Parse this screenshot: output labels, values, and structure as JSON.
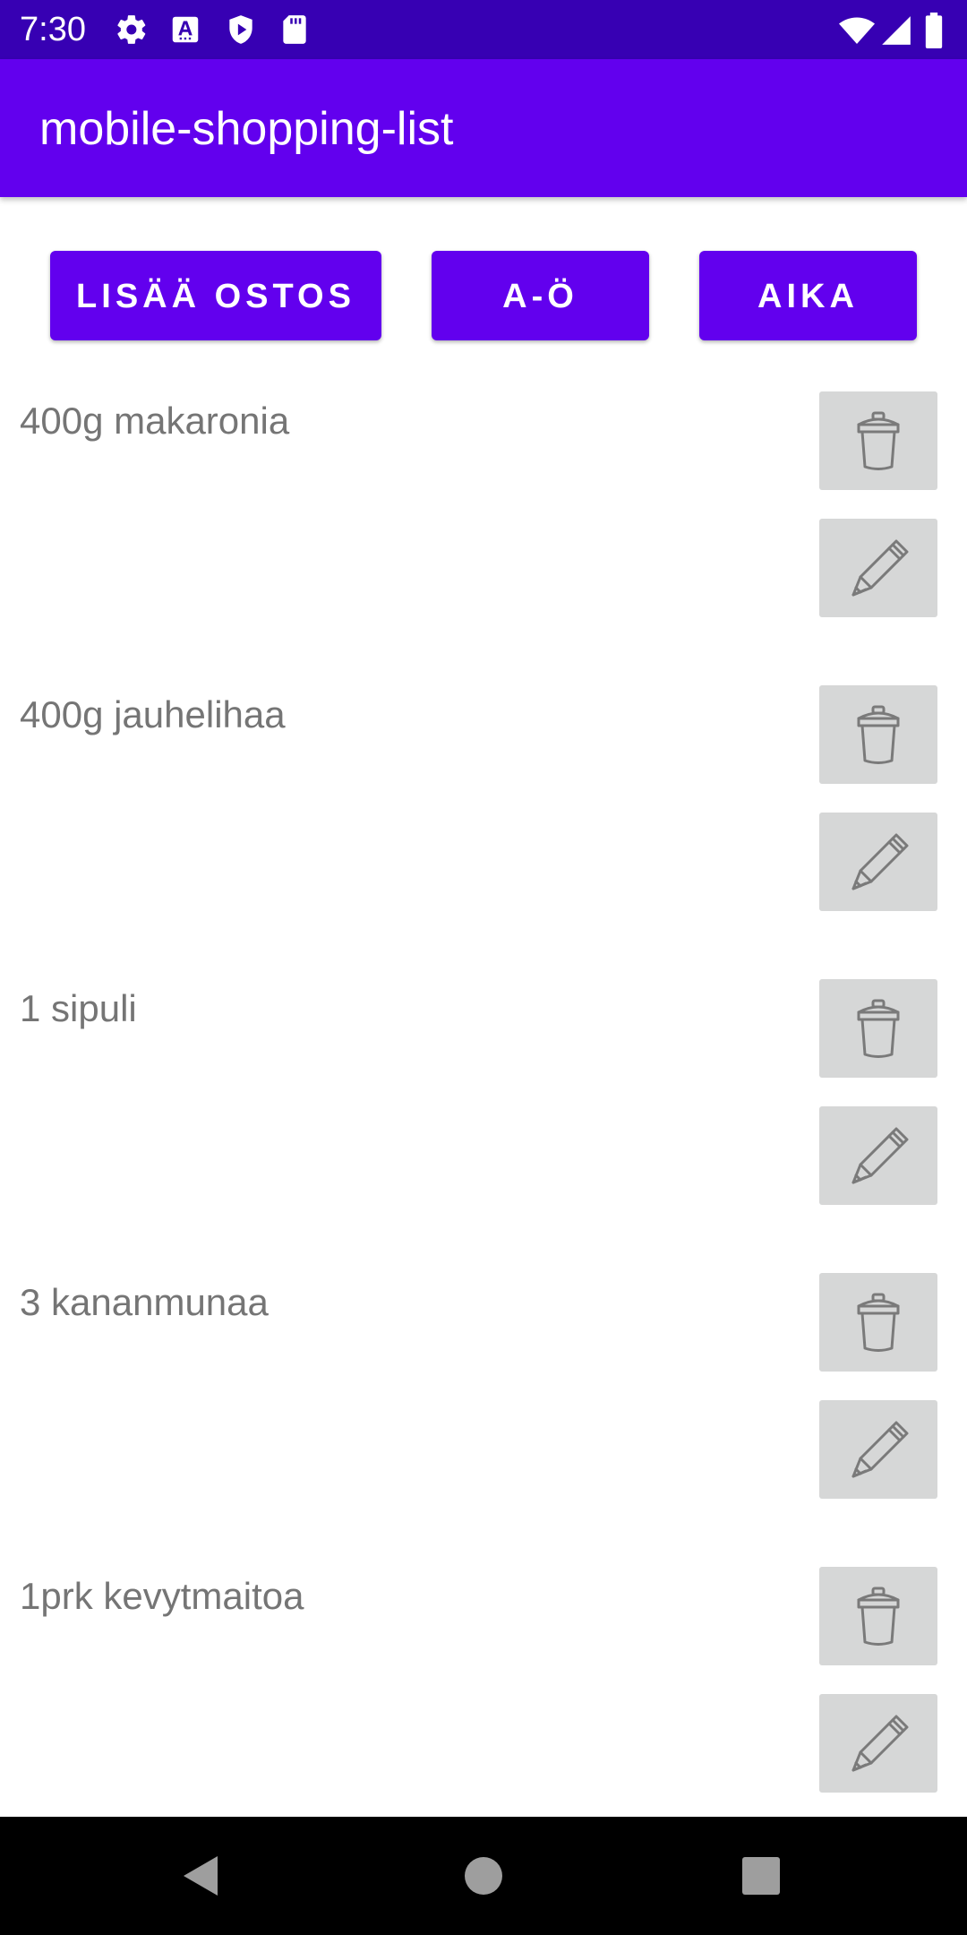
{
  "status_bar": {
    "time": "7:30",
    "left_icons": [
      "gear-icon",
      "font-a-icon",
      "shield-play-icon",
      "sd-card-icon"
    ],
    "right_icons": [
      "wifi-icon",
      "signal-icon",
      "battery-icon"
    ]
  },
  "app_bar": {
    "title": "mobile-shopping-list"
  },
  "actions": {
    "add_label": "LISÄÄ OSTOS",
    "sort_alpha_label": "A-Ö",
    "sort_time_label": "AIKA"
  },
  "items": [
    {
      "text": "400g makaronia"
    },
    {
      "text": "400g jauhelihaa"
    },
    {
      "text": "1 sipuli"
    },
    {
      "text": "3 kananmunaa"
    },
    {
      "text": "1prk kevytmaitoa"
    }
  ],
  "item_icons": {
    "delete": "trash-icon",
    "edit": "pencil-icon"
  },
  "colors": {
    "status_bar": "#3700b3",
    "primary": "#6200ee",
    "icon_button_bg": "#d6d7d7",
    "item_text": "#757575",
    "nav_bar": "#000000"
  },
  "nav_bar": {
    "icons": [
      "back-icon",
      "home-icon",
      "recents-icon"
    ]
  }
}
